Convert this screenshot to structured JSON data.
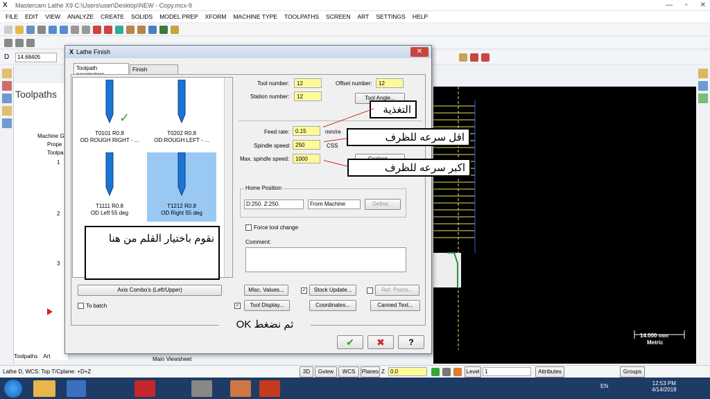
{
  "window": {
    "title": "Mastercam Lathe X9  C:\\Users\\user\\Desktop\\NEW - Copy.mcx-9",
    "controls": [
      "—",
      "▫",
      "✕"
    ]
  },
  "menu": [
    "FILE",
    "EDIT",
    "VIEW",
    "ANALYZE",
    "CREATE",
    "SOLIDS",
    "MODEL PREP",
    "XFORM",
    "MACHINE TYPE",
    "TOOLPATHS",
    "SCREEN",
    "ART",
    "SETTINGS",
    "HELP"
  ],
  "toolbar3": {
    "d_label": "D",
    "d_value": "14.68405"
  },
  "toolpaths_panel": {
    "title": "Toolpaths",
    "tree": [
      "Machine Gr",
      "Prope",
      "Toolpa",
      "1",
      "2",
      "3"
    ],
    "bottom_tabs": [
      "Toolpaths",
      "Art"
    ]
  },
  "dialog": {
    "title": "Lathe Finish",
    "tabs": [
      "Toolpath parameters",
      "Finish parameters"
    ],
    "tools": [
      {
        "name": "T0101 R0.8",
        "desc": "OD ROUGH RIGHT - ...",
        "checked": "✓"
      },
      {
        "name": "T0202 R0.8",
        "desc": "OD ROUGH LEFT - ..."
      },
      {
        "name": "T1111 R0.8",
        "desc": "OD Left 55 deg"
      },
      {
        "name": "T1212 R0.8",
        "desc": "OD Right 55 deg"
      }
    ],
    "tool_number_label": "Tool number:",
    "tool_number": "12",
    "offset_number_label": "Offset number:",
    "offset_number": "12",
    "station_number_label": "Station number:",
    "station_number": "12",
    "tool_angle_btn": "Tool Angle...",
    "feed_rate_label": "Feed rate:",
    "feed_rate": "0.15",
    "feed_unit": "mm/re",
    "spindle_speed_label": "Spindle speed:",
    "spindle_speed": "250",
    "spindle_unit": "CSS",
    "max_spindle_label": "Max. spindle speed:",
    "max_spindle": "1000",
    "coolant_btn": "Coolant...",
    "home_position_label": "Home Position",
    "home_value": "D:250.  Z:250.",
    "from_machine": "From Machine",
    "define_btn": "Define...",
    "force_tool_change": "Force tool change",
    "comment_label": "Comment:",
    "axis_combo_btn": "Axis Combo's (Left/Upper)",
    "misc_values_btn": "Misc. Values...",
    "stock_update_btn": "Stock Update...",
    "ref_points_btn": "Ref. Points...",
    "to_batch": "To batch",
    "tool_display_btn": "Tool Display...",
    "coordinates_btn": "Coordinates...",
    "canned_text_btn": "Canned Text...",
    "ok_icon": "✔",
    "cancel_icon": "✖",
    "help_icon": "?"
  },
  "annotations": {
    "feed": "التغذية",
    "min_speed": "اقل سرعه للظرف",
    "max_speed": "اكبر سرعه للظرف",
    "choose_tool": "نقوم باختيار القلم  من هنا",
    "press_ok": "ثم نضغط OK"
  },
  "viewport": {
    "scale_value": "14.000 mm",
    "scale_unit": "Metric",
    "tab_label": "Main Viewsheet"
  },
  "statusbar": {
    "left": "Lathe D, WCS: Top  T/Cplane: +D+Z",
    "items": [
      "3D",
      "Gview",
      "WCS",
      "Planes",
      "Z",
      "0.0",
      "Level",
      "1",
      "Attributes",
      "Groups"
    ]
  },
  "taskbar": {
    "time": "12:53 PM",
    "date": "4/14/2019",
    "lang": "EN"
  },
  "colors": {
    "field_bg": "#fffa99",
    "selected_tool": "#99c9f3",
    "arrow": "#d12a2a",
    "tool_blue": "#1b74d4"
  }
}
